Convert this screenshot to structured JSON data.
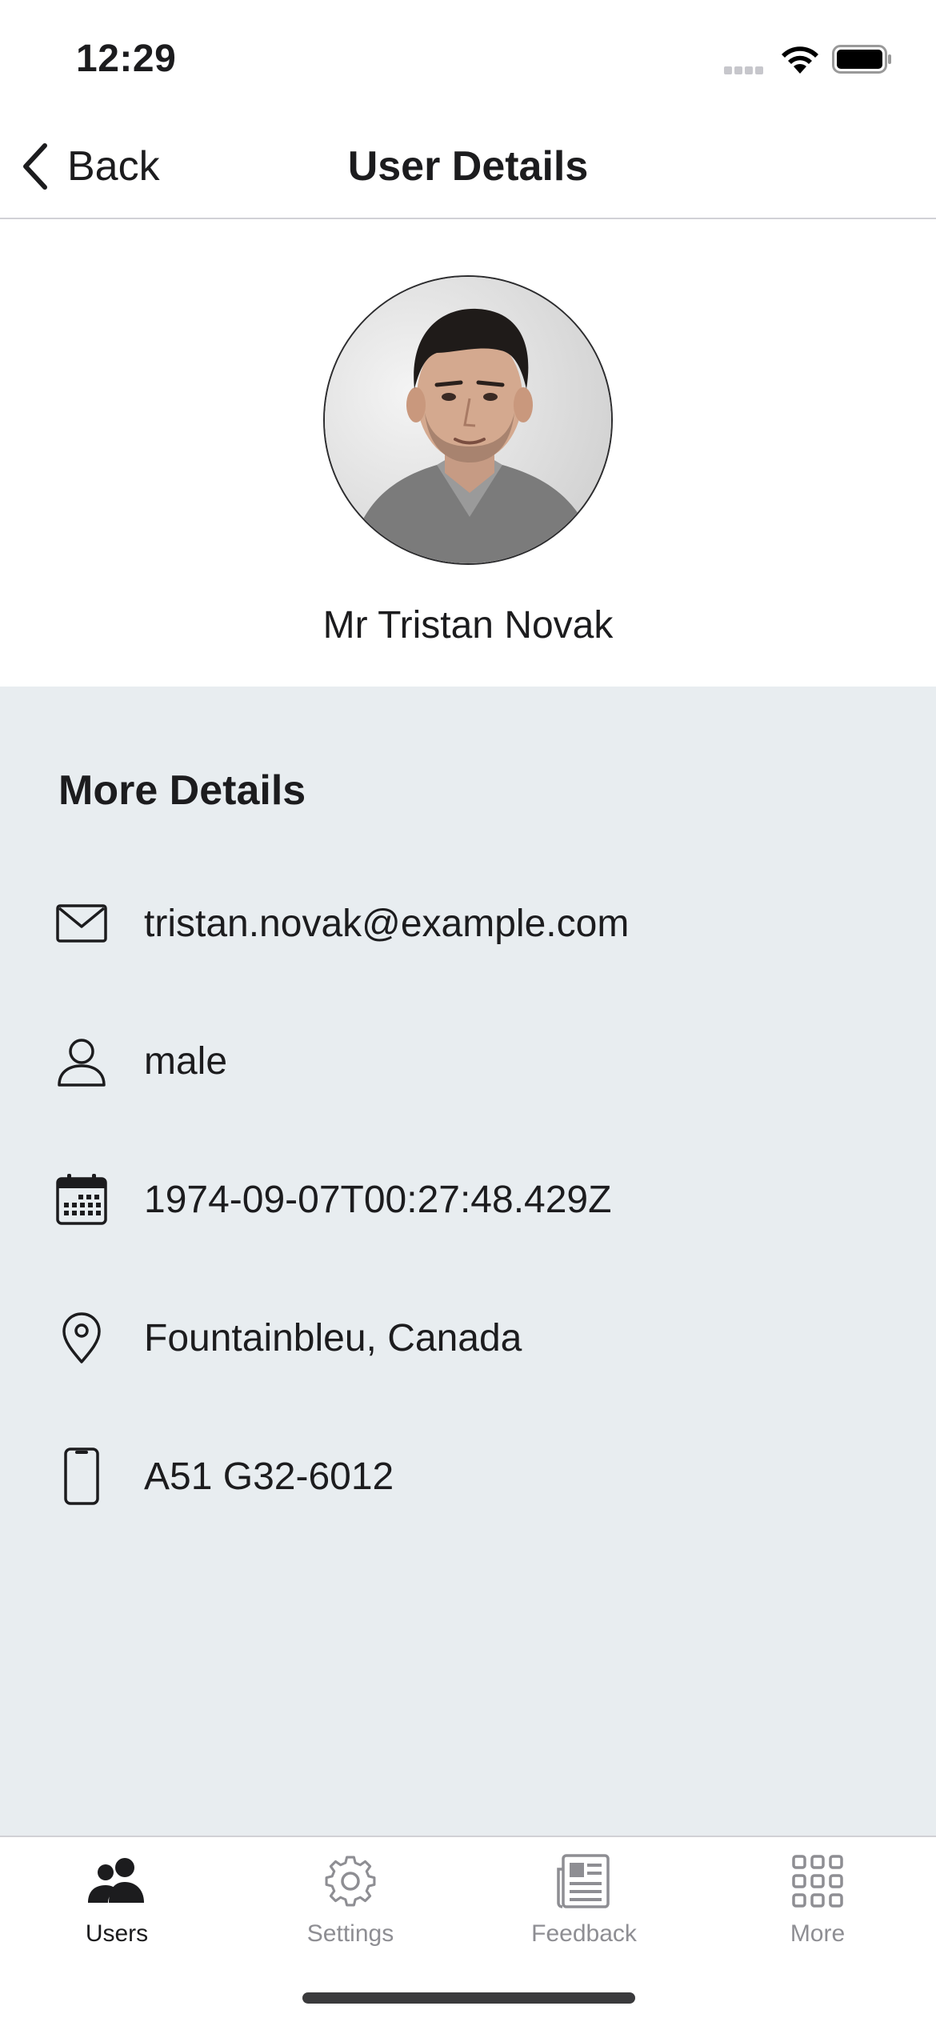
{
  "status_bar": {
    "time": "12:29"
  },
  "nav": {
    "back_label": "Back",
    "title": "User Details"
  },
  "profile": {
    "name": "Mr Tristan Novak"
  },
  "details": {
    "title": "More Details",
    "items": [
      {
        "icon": "mail-icon",
        "text": "tristan.novak@example.com"
      },
      {
        "icon": "person-icon",
        "text": "male"
      },
      {
        "icon": "calendar-icon",
        "text": "1974-09-07T00:27:48.429Z"
      },
      {
        "icon": "location-pin-icon",
        "text": "Fountainbleu, Canada"
      },
      {
        "icon": "phone-icon",
        "text": "A51 G32-6012"
      }
    ]
  },
  "tabs": [
    {
      "label": "Users",
      "icon": "users-icon",
      "active": true
    },
    {
      "label": "Settings",
      "icon": "gear-icon",
      "active": false
    },
    {
      "label": "Feedback",
      "icon": "newspaper-icon",
      "active": false
    },
    {
      "label": "More",
      "icon": "grid-icon",
      "active": false
    }
  ],
  "colors": {
    "details_bg": "#e8edf0",
    "active_tab": "#1c1c1e",
    "inactive_tab": "#8e8e93"
  }
}
